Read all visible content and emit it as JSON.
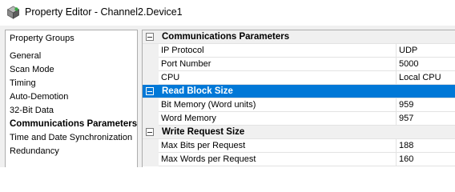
{
  "window": {
    "title": "Property Editor - Channel2.Device1",
    "icon": "property-editor-app-icon"
  },
  "left": {
    "header": "Property Groups",
    "items": [
      {
        "label": "General",
        "selected": false
      },
      {
        "label": "Scan Mode",
        "selected": false
      },
      {
        "label": "Timing",
        "selected": false
      },
      {
        "label": "Auto-Demotion",
        "selected": false
      },
      {
        "label": "32-Bit Data",
        "selected": false
      },
      {
        "label": "Communications Parameters",
        "selected": true
      },
      {
        "label": "Time and Date Synchronization",
        "selected": false
      },
      {
        "label": "Redundancy",
        "selected": false
      }
    ]
  },
  "grid": {
    "categories": [
      {
        "label": "Communications Parameters",
        "selected": false,
        "rows": [
          {
            "name": "IP Protocol",
            "value": "UDP"
          },
          {
            "name": "Port Number",
            "value": "5000"
          },
          {
            "name": "CPU",
            "value": "Local CPU"
          }
        ]
      },
      {
        "label": "Read Block Size",
        "selected": true,
        "rows": [
          {
            "name": "Bit Memory (Word units)",
            "value": "959"
          },
          {
            "name": "Word Memory",
            "value": "957"
          }
        ]
      },
      {
        "label": "Write Request Size",
        "selected": false,
        "rows": [
          {
            "name": "Max Bits per Request",
            "value": "188"
          },
          {
            "name": "Max Words per Request",
            "value": "160"
          }
        ]
      }
    ]
  },
  "colors": {
    "selection": "#0078d7",
    "category_background": "#f0f0f0",
    "grid_line": "#e3e3e3"
  }
}
